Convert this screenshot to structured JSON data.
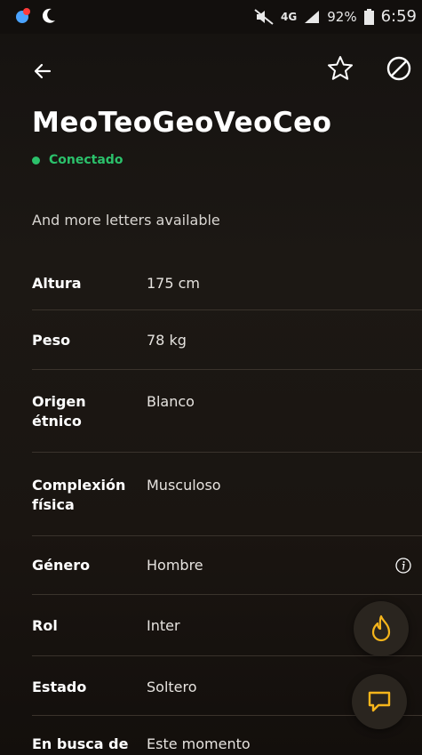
{
  "status_bar": {
    "network": "4G",
    "battery": "92%",
    "time": "6:59"
  },
  "profile": {
    "name": "MeoTeoGeoVeoCeo",
    "status": "Conectado",
    "about": "And more letters available"
  },
  "details": [
    {
      "label": "Altura",
      "value": "175 cm"
    },
    {
      "label": "Peso",
      "value": "78 kg"
    },
    {
      "label": "Origen étnico",
      "value": "Blanco"
    },
    {
      "label": "Complexión física",
      "value": "Musculoso"
    },
    {
      "label": "Género",
      "value": "Hombre"
    },
    {
      "label": "Rol",
      "value": "Inter"
    },
    {
      "label": "Estado",
      "value": "Soltero"
    },
    {
      "label": "En busca de",
      "value": "Este momento"
    }
  ],
  "colors": {
    "online": "#2bc16b",
    "accent": "#f5b51b"
  },
  "icons": {
    "back": "arrow-left-icon",
    "favorite": "star-icon",
    "block": "block-icon",
    "info": "info-icon",
    "tap": "flame-icon",
    "chat": "chat-icon"
  }
}
